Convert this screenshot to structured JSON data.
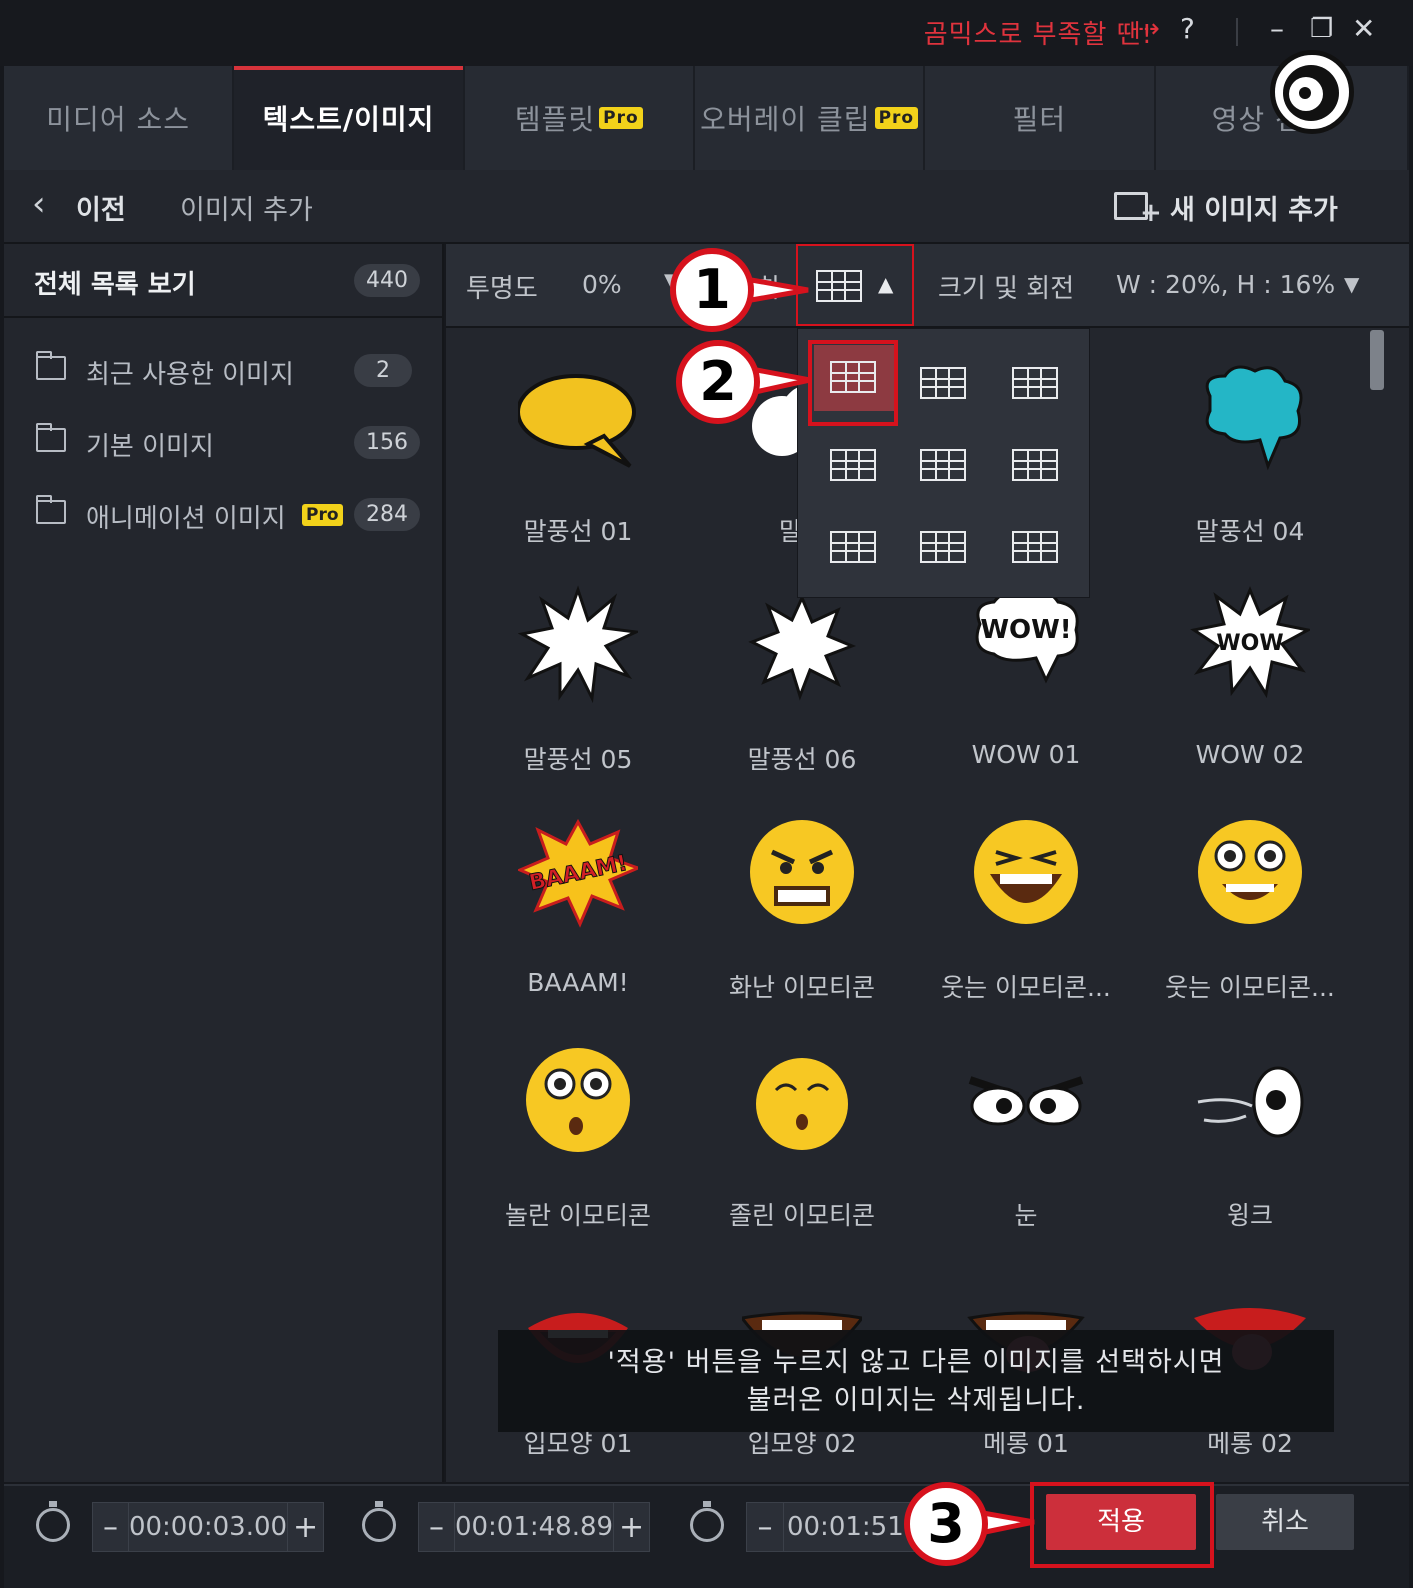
{
  "titlebar": {
    "promo": "곰믹스로 부족할 땐!",
    "help": "?",
    "minimize": "–",
    "restore": "❐",
    "close": "✕"
  },
  "tabs": [
    {
      "label": "미디어 소스",
      "pro": ""
    },
    {
      "label": "텍스트/이미지",
      "pro": ""
    },
    {
      "label": "템플릿",
      "pro": "Pro"
    },
    {
      "label": "오버레이 클립",
      "pro": "Pro"
    },
    {
      "label": "필터",
      "pro": ""
    },
    {
      "label": "영상 전",
      "pro": ""
    }
  ],
  "subheader": {
    "back": "이전",
    "title": "이미지 추가",
    "add_new": "새 이미지 추가"
  },
  "sidebar": {
    "all": {
      "label": "전체 목록 보기",
      "count": "440"
    },
    "folders": [
      {
        "label": "최근 사용한 이미지",
        "count": "2",
        "pro": ""
      },
      {
        "label": "기본 이미지",
        "count": "156",
        "pro": ""
      },
      {
        "label": "애니메이션 이미지",
        "count": "284",
        "pro": "Pro"
      }
    ]
  },
  "toolbar": {
    "opacity_label": "투명도",
    "opacity_value": "0%",
    "position_label": "치",
    "size_label": "크기 및 회전",
    "size_value": "W : 20%, H : 16%"
  },
  "items": [
    {
      "label": "말풍선 01",
      "icon": "yellow-speech-bubble-icon"
    },
    {
      "label": "말풍",
      "icon": "white-cloud-bubble-icon"
    },
    {
      "label": "",
      "icon": "hidden-item-icon"
    },
    {
      "label": "말풍선 04",
      "icon": "teal-cloud-bubble-icon"
    },
    {
      "label": "말풍선 05",
      "icon": "spiky-burst-icon"
    },
    {
      "label": "말풍선 06",
      "icon": "star-burst-icon"
    },
    {
      "label": "WOW 01",
      "icon": "wow-cloud-icon"
    },
    {
      "label": "WOW 02",
      "icon": "wow-burst-icon"
    },
    {
      "label": "BAAAM!",
      "icon": "baaam-icon"
    },
    {
      "label": "화난 이모티콘",
      "icon": "angry-face-icon"
    },
    {
      "label": "웃는 이모티콘...",
      "icon": "laughing-face-icon"
    },
    {
      "label": "웃는 이모티콘...",
      "icon": "smiling-face-icon"
    },
    {
      "label": "놀란 이모티콘",
      "icon": "surprised-face-icon"
    },
    {
      "label": "졸린 이모티콘",
      "icon": "sleepy-face-icon"
    },
    {
      "label": "눈",
      "icon": "eyes-icon"
    },
    {
      "label": "윙크",
      "icon": "wink-icon"
    },
    {
      "label": "입모양 01",
      "icon": "mouth-icon"
    },
    {
      "label": "입모양 02",
      "icon": "mouth-icon"
    },
    {
      "label": "메롱 01",
      "icon": "tongue-icon"
    },
    {
      "label": "메롱 02",
      "icon": "tongue-icon"
    }
  ],
  "toast": {
    "line1": "'적용' 버튼을 누르지 않고 다른 이미지를 선택하시면",
    "line2": "불러온 이미지는 삭제됩니다."
  },
  "bottom": {
    "time1": "00:00:03.00",
    "time2": "00:01:48.89",
    "time3": "00:01:51.",
    "minus": "–",
    "plus": "+",
    "apply": "적용",
    "cancel": "취소"
  },
  "annotations": [
    "1",
    "2",
    "3"
  ],
  "colors": {
    "accent": "#d7333b",
    "pro_badge": "#f2d21a",
    "annotation": "#d6121d"
  }
}
